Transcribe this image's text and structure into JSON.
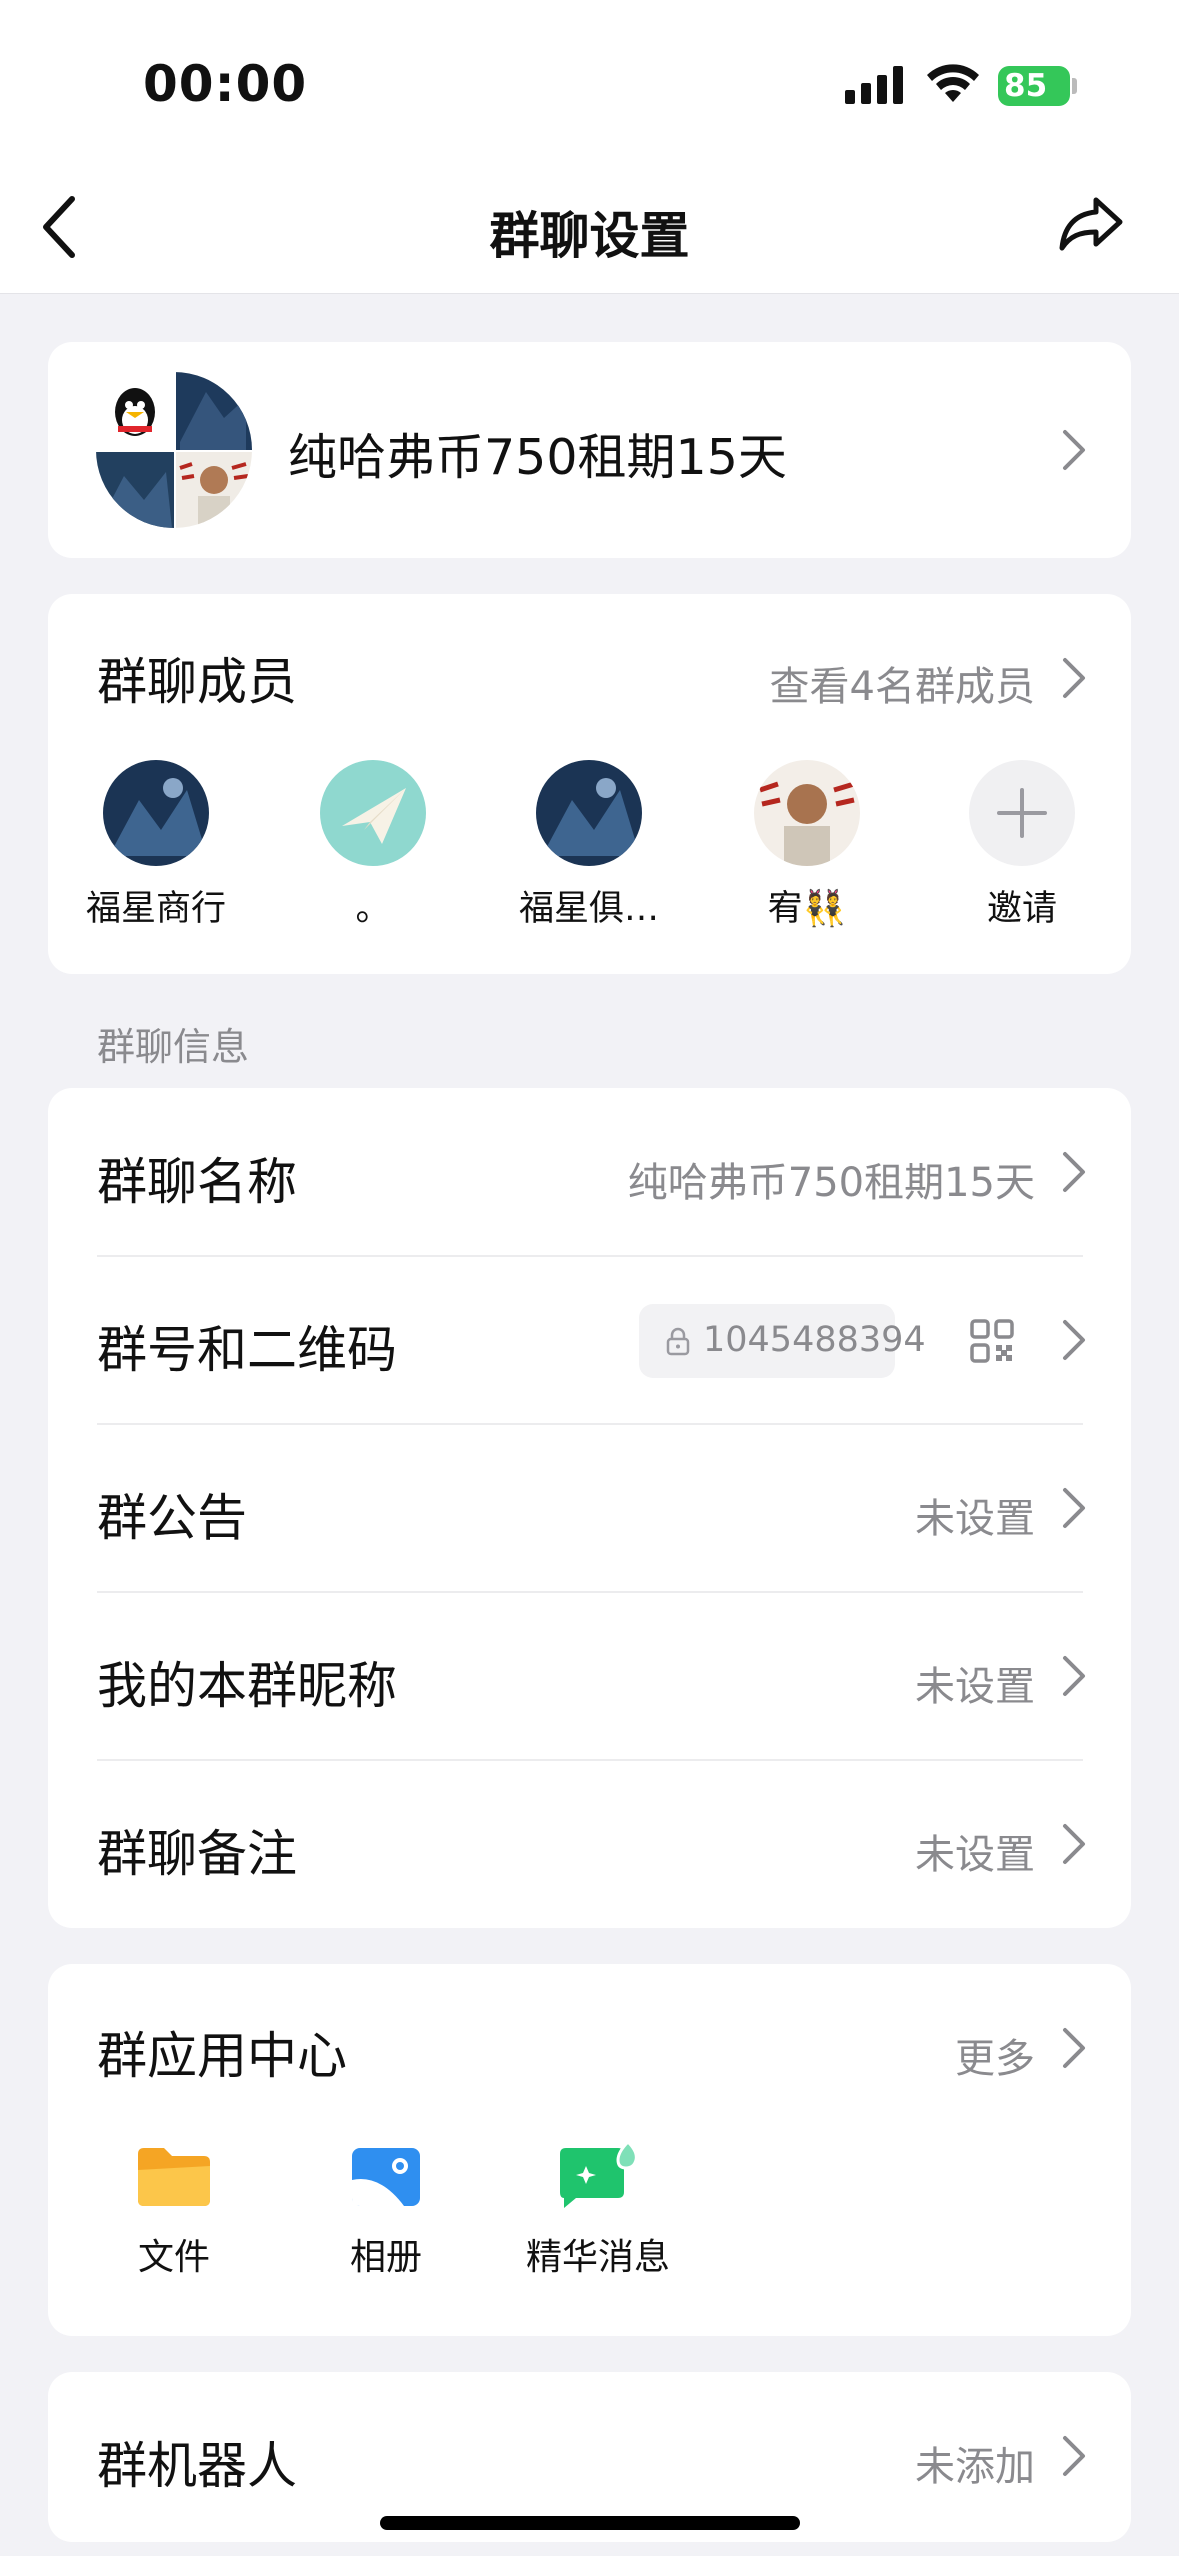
{
  "status_bar": {
    "time": "00:00",
    "battery": "85"
  },
  "nav": {
    "title": "群聊设置"
  },
  "group_header": {
    "name": "纯哈弗币750租期15天"
  },
  "members": {
    "title": "群聊成员",
    "view_all": "查看4名群成员",
    "list": [
      {
        "name": "福星商行"
      },
      {
        "name": "。"
      },
      {
        "name": "福星俱…"
      },
      {
        "name": "宥👯"
      }
    ],
    "invite_label": "邀请"
  },
  "info_section": {
    "label": "群聊信息"
  },
  "info_rows": {
    "name": {
      "label": "群聊名称",
      "value": "纯哈弗币750租期15天"
    },
    "number": {
      "label": "群号和二维码",
      "value": "1045488394"
    },
    "notice": {
      "label": "群公告",
      "value": "未设置"
    },
    "nickname": {
      "label": "我的本群昵称",
      "value": "未设置"
    },
    "remark": {
      "label": "群聊备注",
      "value": "未设置"
    }
  },
  "apps": {
    "title": "群应用中心",
    "more": "更多",
    "items": [
      {
        "label": "文件",
        "icon": "folder-icon"
      },
      {
        "label": "相册",
        "icon": "album-icon"
      },
      {
        "label": "精华消息",
        "icon": "essence-message-icon"
      }
    ]
  },
  "robot": {
    "label": "群机器人",
    "value": "未添加"
  },
  "colors": {
    "battery": "#34c759",
    "folder": "#f5b731",
    "album": "#2f8ff0",
    "essence": "#1fc46d"
  }
}
